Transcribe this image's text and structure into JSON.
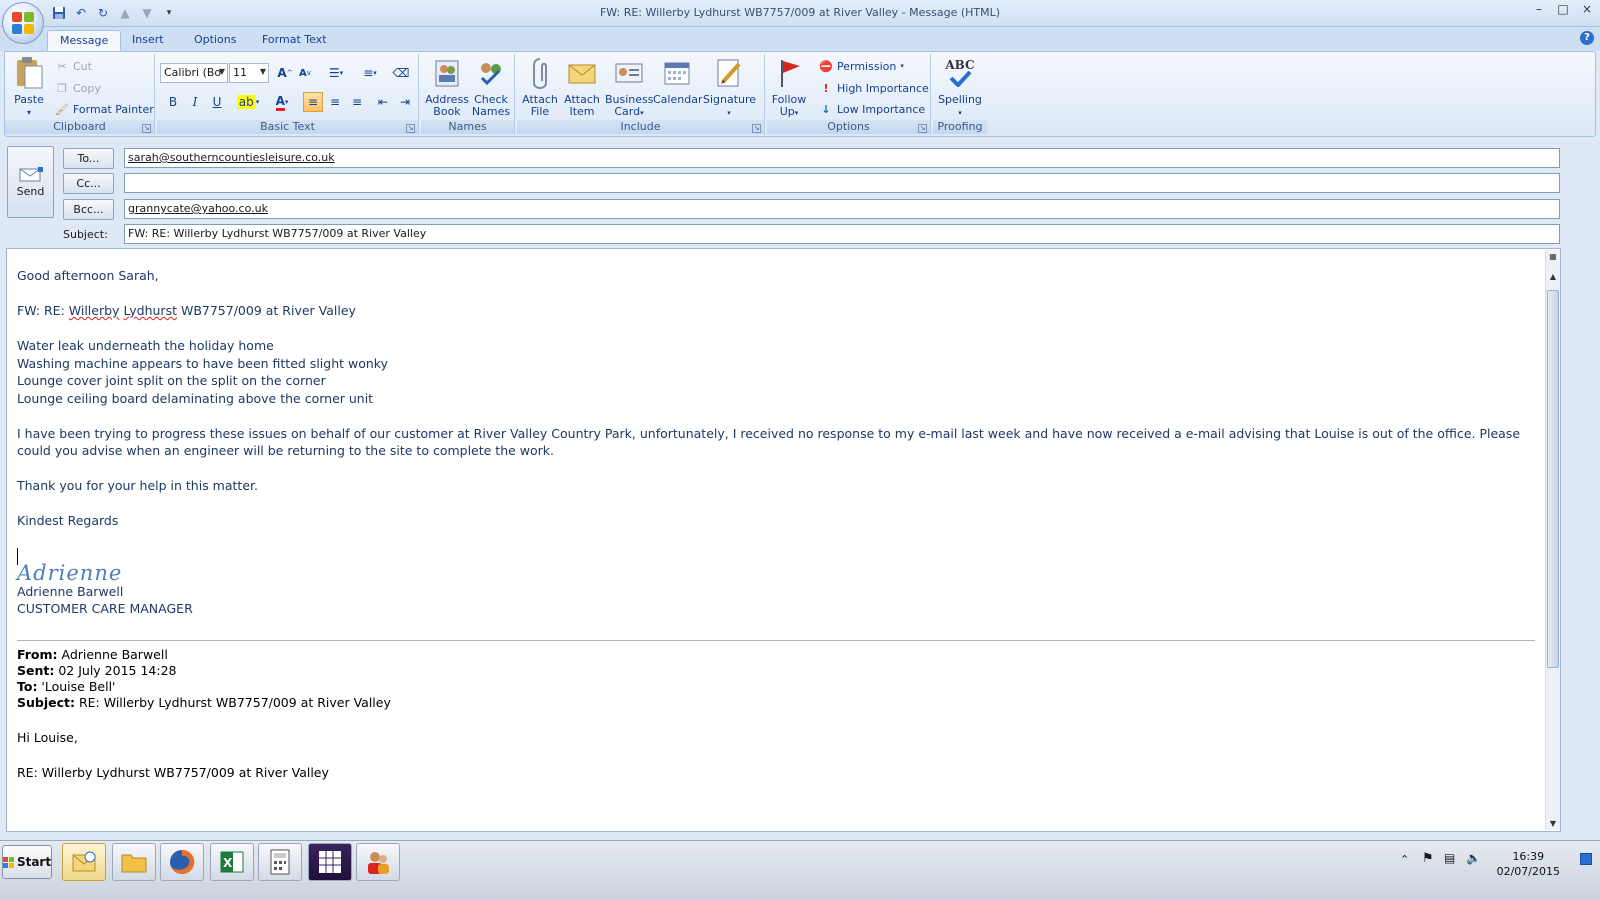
{
  "window": {
    "title": "FW: RE: Willerby Lydhurst WB7757/009  at River Valley - Message (HTML)",
    "controls": {
      "minimize": "–",
      "maximize": "□",
      "close": "×"
    }
  },
  "ribbon": {
    "tabs": [
      "Message",
      "Insert",
      "Options",
      "Format Text"
    ],
    "active_tab": "Message",
    "help": "?",
    "clipboard": {
      "label": "Clipboard",
      "paste": "Paste",
      "cut": "Cut",
      "copy": "Copy",
      "format_painter": "Format Painter"
    },
    "basic_text": {
      "label": "Basic Text",
      "font": "Calibri (Bo",
      "size": "11",
      "bold": "B",
      "italic": "I",
      "underline": "U"
    },
    "names": {
      "label": "Names",
      "address_book": [
        "Address",
        "Book"
      ],
      "check_names": [
        "Check",
        "Names"
      ]
    },
    "include": {
      "label": "Include",
      "attach_file": [
        "Attach",
        "File"
      ],
      "attach_item": [
        "Attach",
        "Item"
      ],
      "business_card": [
        "Business",
        "Card"
      ],
      "calendar": "Calendar",
      "signature": "Signature"
    },
    "options": {
      "label": "Options",
      "follow_up": [
        "Follow",
        "Up"
      ],
      "permission": "Permission",
      "high_importance": "High Importance",
      "low_importance": "Low Importance"
    },
    "proofing": {
      "label": "Proofing",
      "spelling": "Spelling",
      "abc": "ABC"
    }
  },
  "header": {
    "send_label": "Send",
    "to_label": "To...",
    "cc_label": "Cc...",
    "bcc_label": "Bcc...",
    "subject_label": "Subject:",
    "to_value": "sarah@southerncountiesleisure.co.uk",
    "cc_value": "",
    "bcc_value": "grannycate@yahoo.co.uk",
    "subject_value": "FW: RE: Willerby Lydhurst WB7757/009  at River Valley"
  },
  "body": {
    "greeting": "Good afternoon Sarah,",
    "ref_prefix": "FW: RE: ",
    "ref_word1": "Willerby",
    "ref_word2": "Lydhurst",
    "ref_suffix": " WB7757/009  at River Valley",
    "issues": [
      "Water leak underneath the holiday home",
      "Washing machine appears to have been fitted slight wonky",
      "Lounge cover joint split on the split on the corner",
      "Lounge ceiling board delaminating above the corner unit"
    ],
    "paragraph": "I have been trying to progress these issues on behalf of our customer at River Valley Country Park, unfortunately, I received no response to my e-mail last week and have now received a e-mail advising that Louise is out of the office.  Please  could you advise when an engineer will be returning to the site to complete the work.",
    "thanks": "Thank you for your help in this matter.",
    "closing": "Kindest Regards",
    "signature_script": "Adrienne",
    "signature_name": "Adrienne Barwell",
    "signature_title": "CUSTOMER CARE MANAGER"
  },
  "original": {
    "from_label": "From:",
    "from_value": " Adrienne Barwell",
    "sent_label": "Sent:",
    "sent_value": " 02 July 2015 14:28",
    "to_label": "To:",
    "to_value": " 'Louise Bell'",
    "subject_label": "Subject:",
    "subject_value": " RE: Willerby Lydhurst WB7757/009 at River Valley",
    "greeting": "Hi Louise,",
    "ref_line": "RE: Willerby Lydhurst WB7757/009  at River Valley"
  },
  "taskbar": {
    "start": "Start",
    "apps": [
      "outlook-app",
      "explorer-app",
      "firefox-app",
      "excel-app",
      "calculator-app",
      "report-app",
      "contacts-app"
    ],
    "time": "16:39",
    "date": "02/07/2015"
  },
  "colors": {
    "accent": "#15428b",
    "body_text": "#1f3864",
    "signature": "#4a7fbf"
  }
}
